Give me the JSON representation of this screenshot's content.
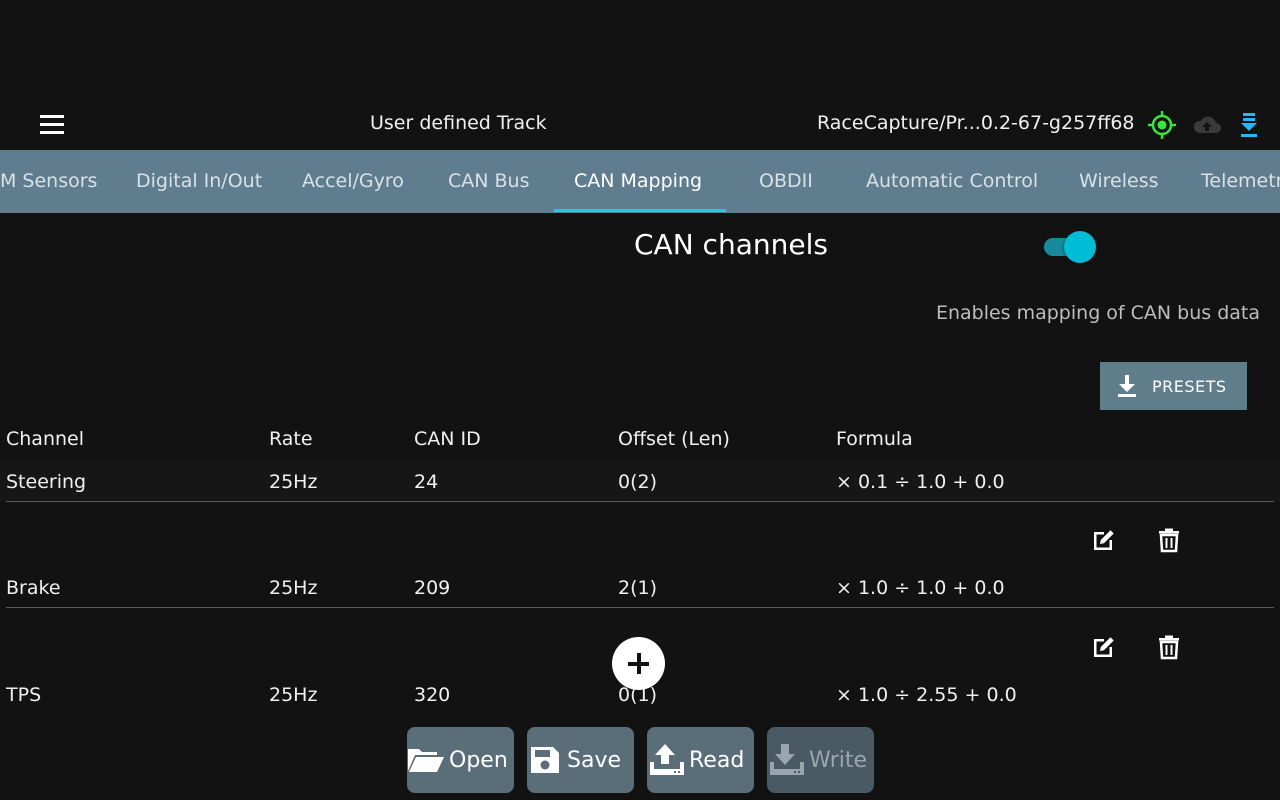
{
  "header": {
    "track_title": "User defined Track",
    "device_name": "RaceCapture/Pr...0.2-67-g257ff68",
    "icons": [
      "menu-icon",
      "gps-target-icon",
      "cloud-upload-icon",
      "download-status-icon"
    ],
    "colors": {
      "gps": "#39e639",
      "cloud": "#3a3a3a",
      "download": "#29b6f6"
    }
  },
  "tabs": [
    {
      "label": "M Sensors"
    },
    {
      "label": "Digital In/Out"
    },
    {
      "label": "Accel/Gyro"
    },
    {
      "label": "CAN Bus"
    },
    {
      "label": "CAN Mapping",
      "active": true
    },
    {
      "label": "OBDII"
    },
    {
      "label": "Automatic Control"
    },
    {
      "label": "Wireless"
    },
    {
      "label": "Telemetr"
    }
  ],
  "section": {
    "title": "CAN channels",
    "enabled": true,
    "help": "Enables mapping of CAN bus data",
    "presets_label": "PRESETS"
  },
  "table": {
    "headers": [
      "Channel",
      "Rate",
      "CAN ID",
      "Offset (Len)",
      "Formula"
    ],
    "rows": [
      {
        "channel": "Steering",
        "rate": "25Hz",
        "can_id": "24",
        "offset": "0(2)",
        "formula": "× 0.1 ÷ 1.0 + 0.0"
      },
      {
        "channel": "Brake",
        "rate": "25Hz",
        "can_id": "209",
        "offset": "2(1)",
        "formula": "× 1.0 ÷ 1.0 + 0.0"
      },
      {
        "channel": "TPS",
        "rate": "25Hz",
        "can_id": "320",
        "offset": "0(1)",
        "formula": "× 1.0 ÷ 2.55 + 0.0"
      }
    ]
  },
  "footer": {
    "open_label": "Open",
    "save_label": "Save",
    "read_label": "Read",
    "write_label": "Write",
    "write_enabled": false
  }
}
